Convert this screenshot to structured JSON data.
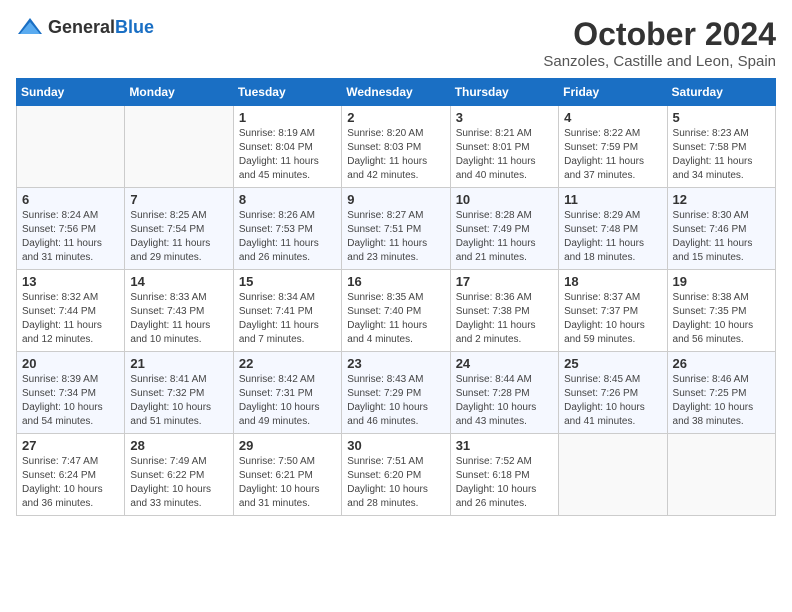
{
  "logo": {
    "general": "General",
    "blue": "Blue"
  },
  "title": {
    "month": "October 2024",
    "location": "Sanzoles, Castille and Leon, Spain"
  },
  "days_of_week": [
    "Sunday",
    "Monday",
    "Tuesday",
    "Wednesday",
    "Thursday",
    "Friday",
    "Saturday"
  ],
  "weeks": [
    [
      {
        "day": "",
        "text": ""
      },
      {
        "day": "",
        "text": ""
      },
      {
        "day": "1",
        "text": "Sunrise: 8:19 AM\nSunset: 8:04 PM\nDaylight: 11 hours and 45 minutes."
      },
      {
        "day": "2",
        "text": "Sunrise: 8:20 AM\nSunset: 8:03 PM\nDaylight: 11 hours and 42 minutes."
      },
      {
        "day": "3",
        "text": "Sunrise: 8:21 AM\nSunset: 8:01 PM\nDaylight: 11 hours and 40 minutes."
      },
      {
        "day": "4",
        "text": "Sunrise: 8:22 AM\nSunset: 7:59 PM\nDaylight: 11 hours and 37 minutes."
      },
      {
        "day": "5",
        "text": "Sunrise: 8:23 AM\nSunset: 7:58 PM\nDaylight: 11 hours and 34 minutes."
      }
    ],
    [
      {
        "day": "6",
        "text": "Sunrise: 8:24 AM\nSunset: 7:56 PM\nDaylight: 11 hours and 31 minutes."
      },
      {
        "day": "7",
        "text": "Sunrise: 8:25 AM\nSunset: 7:54 PM\nDaylight: 11 hours and 29 minutes."
      },
      {
        "day": "8",
        "text": "Sunrise: 8:26 AM\nSunset: 7:53 PM\nDaylight: 11 hours and 26 minutes."
      },
      {
        "day": "9",
        "text": "Sunrise: 8:27 AM\nSunset: 7:51 PM\nDaylight: 11 hours and 23 minutes."
      },
      {
        "day": "10",
        "text": "Sunrise: 8:28 AM\nSunset: 7:49 PM\nDaylight: 11 hours and 21 minutes."
      },
      {
        "day": "11",
        "text": "Sunrise: 8:29 AM\nSunset: 7:48 PM\nDaylight: 11 hours and 18 minutes."
      },
      {
        "day": "12",
        "text": "Sunrise: 8:30 AM\nSunset: 7:46 PM\nDaylight: 11 hours and 15 minutes."
      }
    ],
    [
      {
        "day": "13",
        "text": "Sunrise: 8:32 AM\nSunset: 7:44 PM\nDaylight: 11 hours and 12 minutes."
      },
      {
        "day": "14",
        "text": "Sunrise: 8:33 AM\nSunset: 7:43 PM\nDaylight: 11 hours and 10 minutes."
      },
      {
        "day": "15",
        "text": "Sunrise: 8:34 AM\nSunset: 7:41 PM\nDaylight: 11 hours and 7 minutes."
      },
      {
        "day": "16",
        "text": "Sunrise: 8:35 AM\nSunset: 7:40 PM\nDaylight: 11 hours and 4 minutes."
      },
      {
        "day": "17",
        "text": "Sunrise: 8:36 AM\nSunset: 7:38 PM\nDaylight: 11 hours and 2 minutes."
      },
      {
        "day": "18",
        "text": "Sunrise: 8:37 AM\nSunset: 7:37 PM\nDaylight: 10 hours and 59 minutes."
      },
      {
        "day": "19",
        "text": "Sunrise: 8:38 AM\nSunset: 7:35 PM\nDaylight: 10 hours and 56 minutes."
      }
    ],
    [
      {
        "day": "20",
        "text": "Sunrise: 8:39 AM\nSunset: 7:34 PM\nDaylight: 10 hours and 54 minutes."
      },
      {
        "day": "21",
        "text": "Sunrise: 8:41 AM\nSunset: 7:32 PM\nDaylight: 10 hours and 51 minutes."
      },
      {
        "day": "22",
        "text": "Sunrise: 8:42 AM\nSunset: 7:31 PM\nDaylight: 10 hours and 49 minutes."
      },
      {
        "day": "23",
        "text": "Sunrise: 8:43 AM\nSunset: 7:29 PM\nDaylight: 10 hours and 46 minutes."
      },
      {
        "day": "24",
        "text": "Sunrise: 8:44 AM\nSunset: 7:28 PM\nDaylight: 10 hours and 43 minutes."
      },
      {
        "day": "25",
        "text": "Sunrise: 8:45 AM\nSunset: 7:26 PM\nDaylight: 10 hours and 41 minutes."
      },
      {
        "day": "26",
        "text": "Sunrise: 8:46 AM\nSunset: 7:25 PM\nDaylight: 10 hours and 38 minutes."
      }
    ],
    [
      {
        "day": "27",
        "text": "Sunrise: 7:47 AM\nSunset: 6:24 PM\nDaylight: 10 hours and 36 minutes."
      },
      {
        "day": "28",
        "text": "Sunrise: 7:49 AM\nSunset: 6:22 PM\nDaylight: 10 hours and 33 minutes."
      },
      {
        "day": "29",
        "text": "Sunrise: 7:50 AM\nSunset: 6:21 PM\nDaylight: 10 hours and 31 minutes."
      },
      {
        "day": "30",
        "text": "Sunrise: 7:51 AM\nSunset: 6:20 PM\nDaylight: 10 hours and 28 minutes."
      },
      {
        "day": "31",
        "text": "Sunrise: 7:52 AM\nSunset: 6:18 PM\nDaylight: 10 hours and 26 minutes."
      },
      {
        "day": "",
        "text": ""
      },
      {
        "day": "",
        "text": ""
      }
    ]
  ]
}
